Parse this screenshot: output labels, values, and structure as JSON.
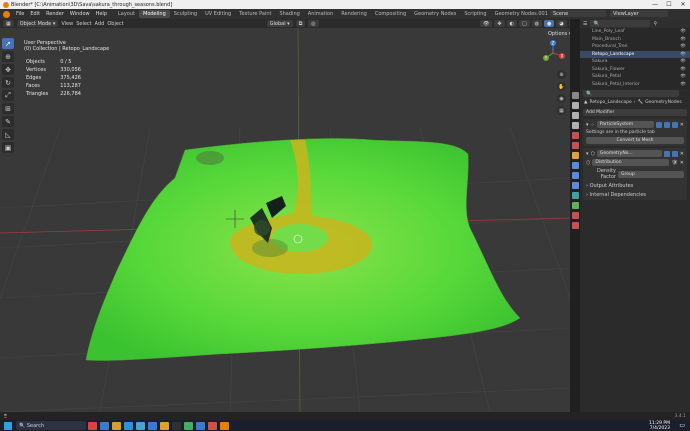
{
  "window": {
    "title": "Blender* [C:\\Animation\\3D\\Sava\\sakura_through_seasons.blend]",
    "min": "—",
    "max": "☐",
    "close": "✕"
  },
  "menu": {
    "items": [
      "File",
      "Edit",
      "Render",
      "Window",
      "Help"
    ],
    "workspaces": [
      "Layout",
      "Modeling",
      "Sculpting",
      "UV Editing",
      "Texture Paint",
      "Shading",
      "Animation",
      "Rendering",
      "Compositing",
      "Geometry Nodes",
      "Scripting",
      "Geometry Nodes.001"
    ],
    "active_workspace": "Modeling",
    "add_tab": "+",
    "scene": "Scene",
    "view_layer": "ViewLayer"
  },
  "viewport_header": {
    "mode": "Object Mode",
    "menus": [
      "View",
      "Select",
      "Add",
      "Object"
    ],
    "transform": "Global",
    "options": "Options"
  },
  "viewport": {
    "view_name": "User Perspective",
    "collection": "(0) Collection | Retopo_Landscape",
    "stats": [
      {
        "label": "Objects",
        "value": "0 / 5"
      },
      {
        "label": "Vertices",
        "value": "330,056"
      },
      {
        "label": "Edges",
        "value": "375,426"
      },
      {
        "label": "Faces",
        "value": "113,287"
      },
      {
        "label": "Triangles",
        "value": "226,784"
      }
    ],
    "gizmo_axes": {
      "x": "X",
      "y": "Y",
      "z": "Z"
    }
  },
  "toolbar": {
    "tools": [
      "select-box",
      "cursor",
      "move",
      "rotate",
      "scale",
      "transform",
      "annotate",
      "measure",
      "add-cube"
    ]
  },
  "outliner": {
    "rows": [
      {
        "label": "Line_Poly_Leaf",
        "selected": false
      },
      {
        "label": "Main_Branch",
        "selected": false
      },
      {
        "label": "Procedural_Tree",
        "selected": false
      },
      {
        "label": "Retopo_Landscape",
        "selected": true
      },
      {
        "label": "Sakura",
        "selected": false
      },
      {
        "label": "Sakura_Flower",
        "selected": false
      },
      {
        "label": "Sakura_Petal",
        "selected": false
      },
      {
        "label": "Sakura_Petal_Interior",
        "selected": false
      }
    ]
  },
  "properties": {
    "breadcrumb_object": "Retopo_Landscape",
    "breadcrumb_modifier": "GeometryNodes",
    "add_modifier": "Add Modifier",
    "particle_modifier": "ParticleSystem",
    "particle_note": "Settings are in the particle tab",
    "convert_button": "Convert to Mesh",
    "geo_modifier": "GeometryNo...",
    "node_group": "Distribution",
    "density_label": "Density Factor",
    "density_value": "Group",
    "sections": [
      "Output Attributes",
      "Internal Dependencies"
    ]
  },
  "statusbar": {
    "version": "3.4.1"
  },
  "taskbar": {
    "search": "Search",
    "time": "11:29 PM",
    "date": "7/4/2023"
  }
}
